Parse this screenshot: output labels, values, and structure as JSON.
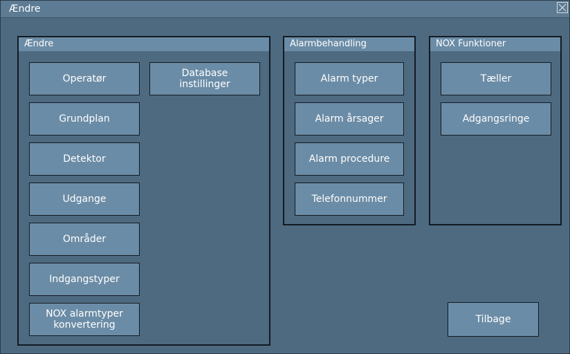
{
  "window": {
    "title": "Ændre",
    "close_icon": "close-icon"
  },
  "groups": {
    "aendre": {
      "title": "Ændre",
      "buttons": {
        "operator": "Operatør",
        "grundplan": "Grundplan",
        "detektor": "Detektor",
        "udgange": "Udgange",
        "omraader": "Områder",
        "indgangstyper": "Indgangstyper",
        "nox_convert": "NOX alarmtyper\nkonvertering",
        "database": "Database\ninstillinger"
      }
    },
    "alarmbehandling": {
      "title": "Alarmbehandling",
      "buttons": {
        "alarm_typer": "Alarm typer",
        "alarm_aarsager": "Alarm årsager",
        "alarm_procedure": "Alarm procedure",
        "telefonnummer": "Telefonnummer"
      }
    },
    "nox_funktioner": {
      "title": "NOX Funktioner",
      "buttons": {
        "taeller": "Tæller",
        "adgangsringe": "Adgangsringe"
      }
    }
  },
  "footer": {
    "tilbage": "Tilbage"
  },
  "colors": {
    "window_bg": "#4e6a80",
    "button_bg": "#6b8ca6",
    "border": "#121a22",
    "text": "#ffffff"
  }
}
